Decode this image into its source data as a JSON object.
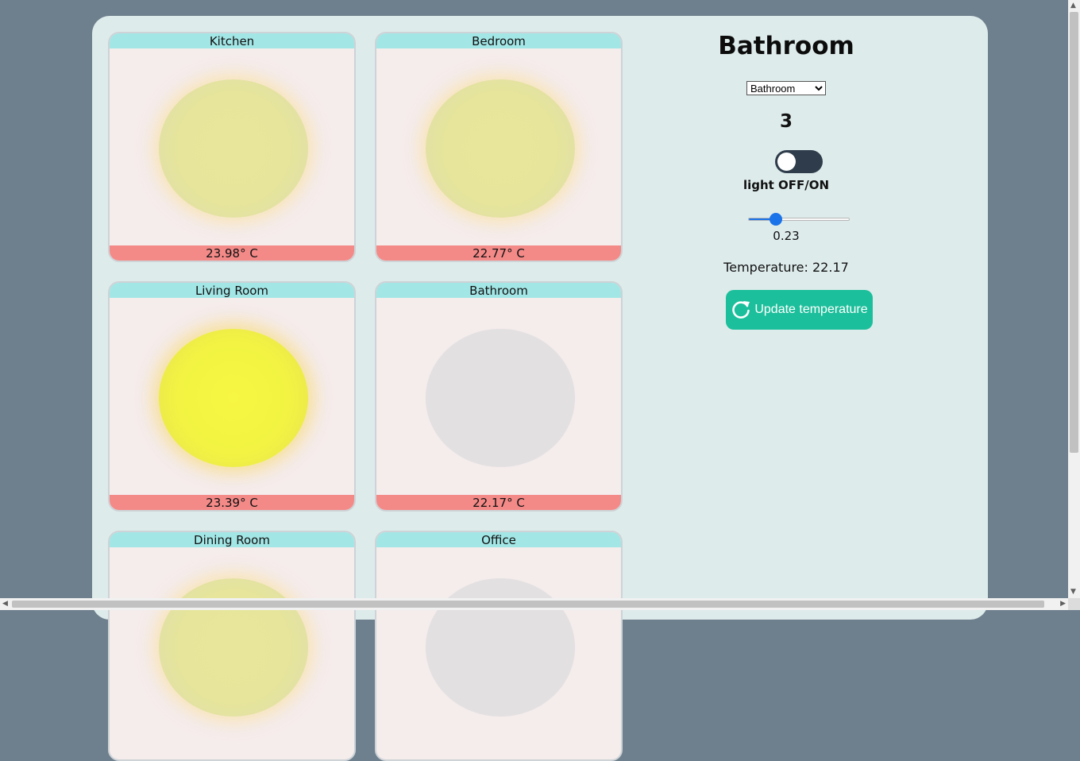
{
  "rooms": [
    {
      "name": "Kitchen",
      "temperature": "23.98° C",
      "light": "dim"
    },
    {
      "name": "Bedroom",
      "temperature": "22.77° C",
      "light": "dim"
    },
    {
      "name": "Living Room",
      "temperature": "23.39° C",
      "light": "bright"
    },
    {
      "name": "Bathroom",
      "temperature": "22.17° C",
      "light": "off"
    },
    {
      "name": "Dining Room",
      "temperature": "",
      "light": "dim"
    },
    {
      "name": "Office",
      "temperature": "",
      "light": "off"
    }
  ],
  "control": {
    "title": "Bathroom",
    "select_value": "Bathroom",
    "level": "3",
    "switch_label": "light OFF/ON",
    "switch_on": false,
    "slider_value": 0.23,
    "slider_text": "0.23",
    "temperature_text": "Temperature: 22.17",
    "update_label": "Update temperature"
  },
  "colors": {
    "background": "#6e7f8d",
    "panel": "#deebeb",
    "card_header": "#a3e6e6",
    "card_footer": "#f38a88",
    "button": "#1cbf9b",
    "switch": "#2e3c4b",
    "slider": "#1a73e8"
  },
  "icons": {
    "update": "refresh-icon"
  }
}
